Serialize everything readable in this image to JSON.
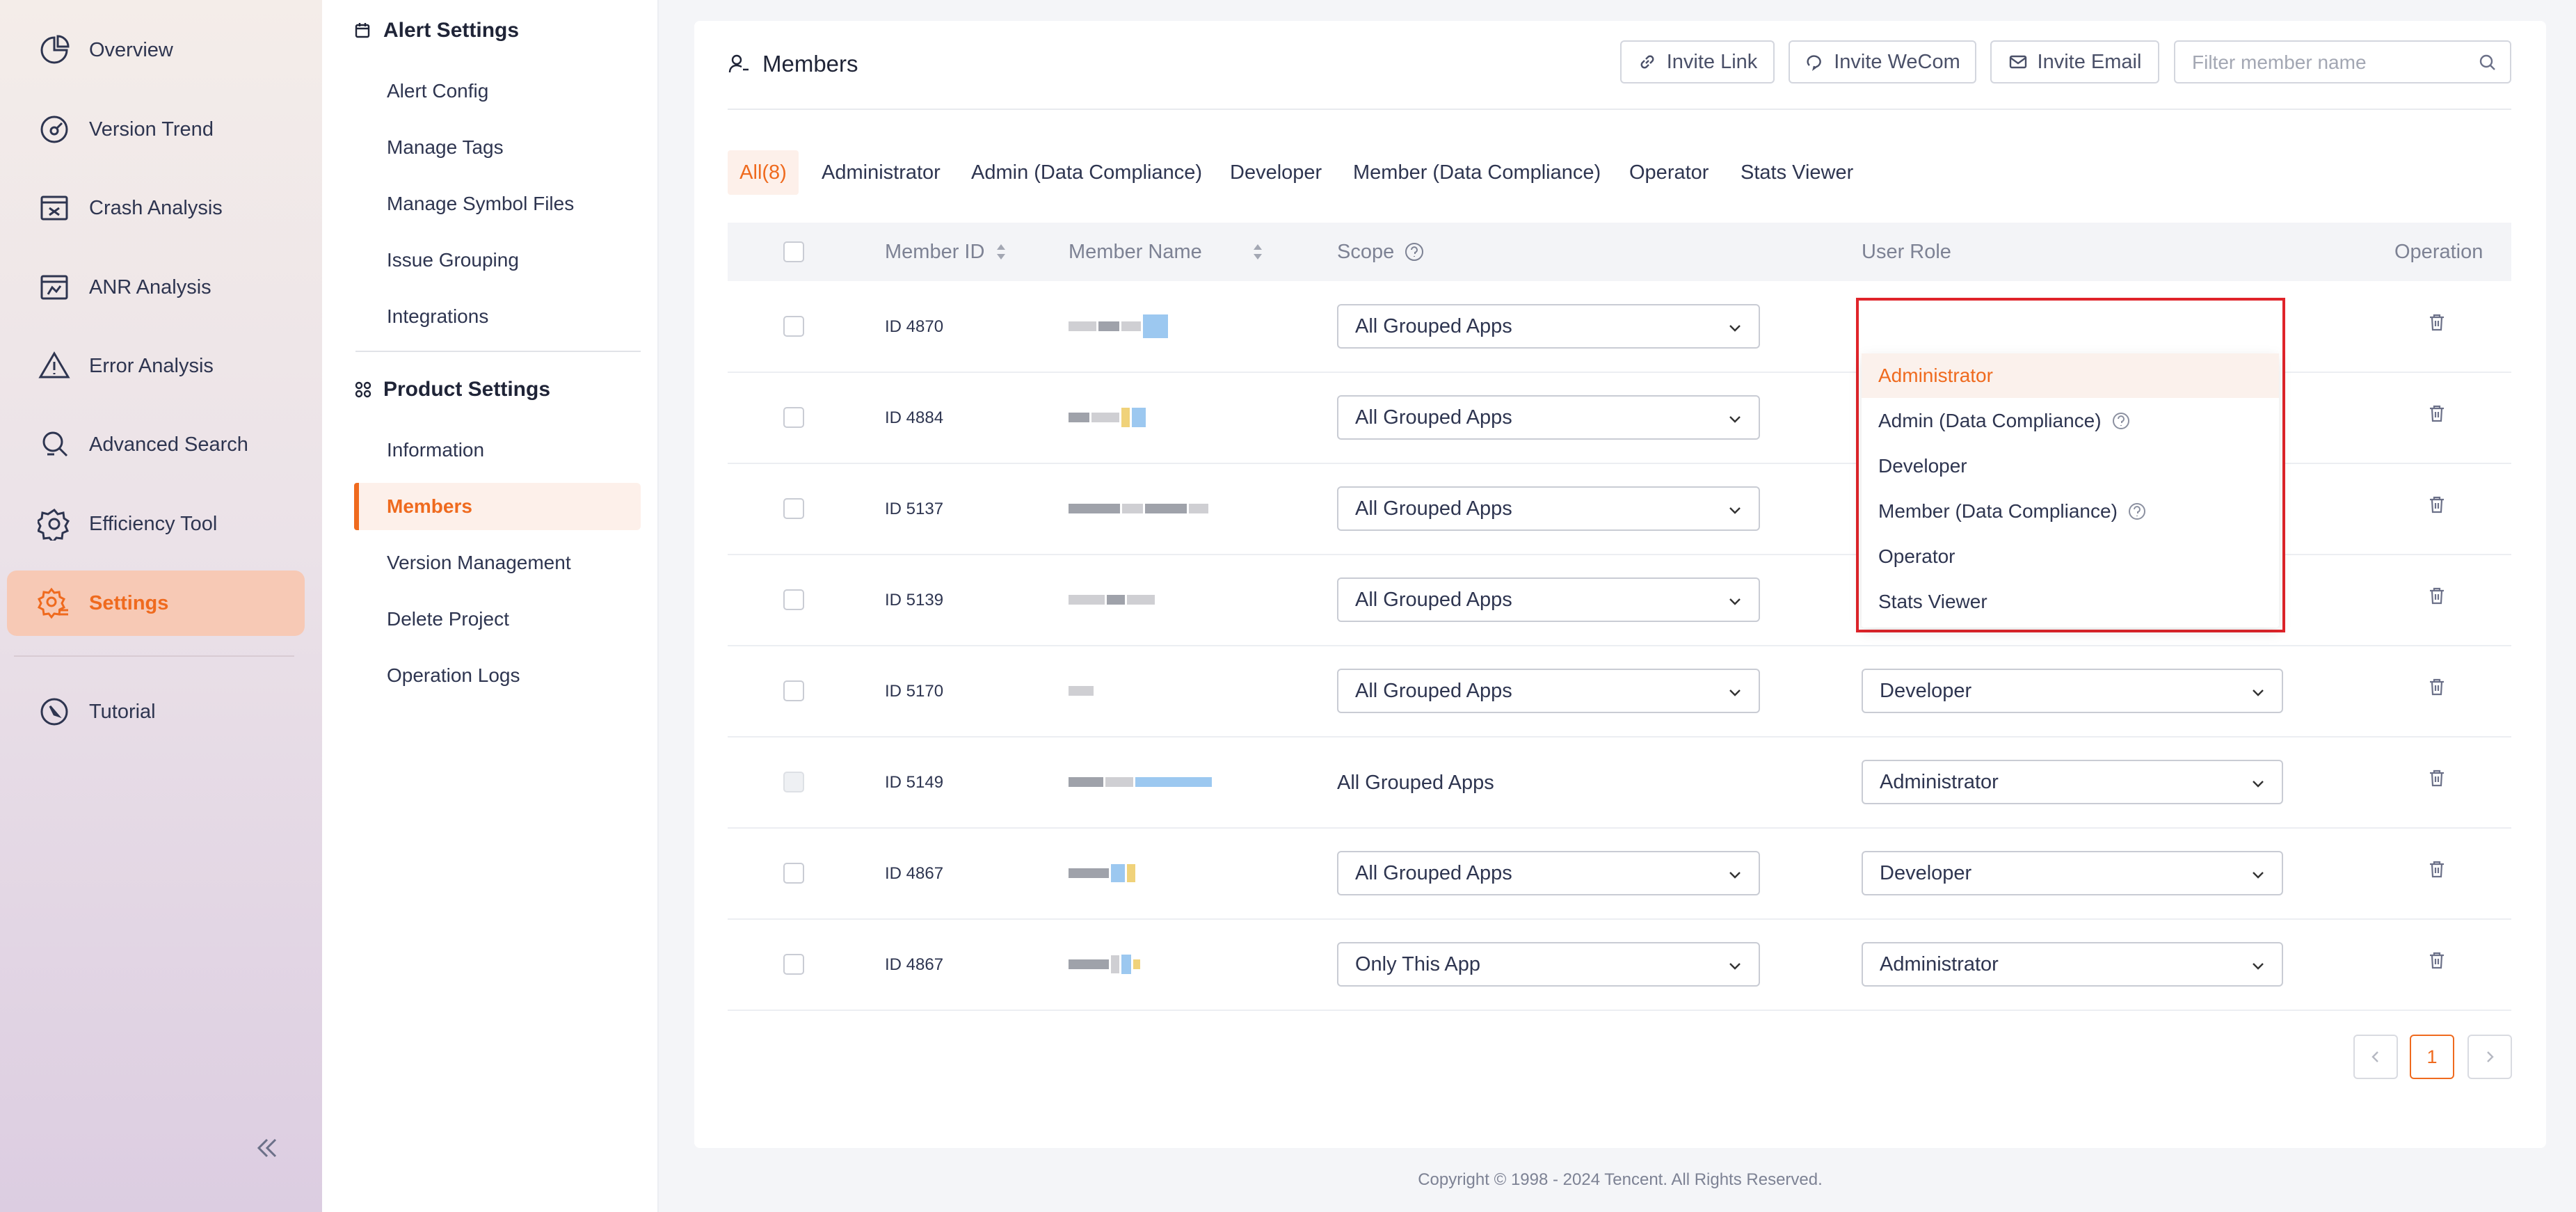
{
  "nav": {
    "items": [
      {
        "label": "Overview",
        "icon": "pie-chart-icon"
      },
      {
        "label": "Version Trend",
        "icon": "gauge-icon"
      },
      {
        "label": "Crash Analysis",
        "icon": "crash-icon"
      },
      {
        "label": "ANR Analysis",
        "icon": "anr-icon"
      },
      {
        "label": "Error Analysis",
        "icon": "warning-icon"
      },
      {
        "label": "Advanced Search",
        "icon": "magnifier-icon"
      },
      {
        "label": "Efficiency Tool",
        "icon": "gear-icon"
      },
      {
        "label": "Settings",
        "icon": "settings-icon"
      },
      {
        "label": "Tutorial",
        "icon": "compass-icon"
      }
    ],
    "active": "Settings"
  },
  "sub_nav": {
    "alert_header": "Alert Settings",
    "alert_items": [
      "Alert Config",
      "Manage Tags",
      "Manage Symbol Files",
      "Issue Grouping",
      "Integrations"
    ],
    "product_header": "Product Settings",
    "product_items": [
      "Information",
      "Members",
      "Version Management",
      "Delete Project",
      "Operation Logs"
    ],
    "active": "Members"
  },
  "page": {
    "title": "Members",
    "invite_link": "Invite Link",
    "invite_wecom": "Invite WeCom",
    "invite_email": "Invite Email",
    "search_placeholder": "Filter member name"
  },
  "tabs": [
    "All(8)",
    "Administrator",
    "Admin (Data Compliance)",
    "Developer",
    "Member (Data Compliance)",
    "Operator",
    "Stats Viewer"
  ],
  "active_tab": "All(8)",
  "table": {
    "headers": {
      "member_id": "Member ID",
      "member_name": "Member Name",
      "scope": "Scope",
      "user_role": "User Role",
      "operation": "Operation"
    },
    "rows": [
      {
        "id": "ID 4870",
        "scope": "All Grouped Apps",
        "role": "Administrator"
      },
      {
        "id": "ID 4884",
        "scope": "All Grouped Apps",
        "role": ""
      },
      {
        "id": "ID 5137",
        "scope": "All Grouped Apps",
        "role": ""
      },
      {
        "id": "ID 5139",
        "scope": "All Grouped Apps",
        "role": ""
      },
      {
        "id": "ID 5170",
        "scope": "All Grouped Apps",
        "role": "Developer"
      },
      {
        "id": "ID 5149",
        "scope": "All Grouped Apps",
        "role": "Administrator",
        "scope_locked": true
      },
      {
        "id": "ID 4867",
        "scope": "All Grouped Apps",
        "role": "Developer"
      },
      {
        "id": "ID 4867",
        "scope": "Only This App",
        "role": "Administrator"
      }
    ]
  },
  "role_dropdown": {
    "options": [
      "Administrator",
      "Admin (Data Compliance)",
      "Developer",
      "Member (Data Compliance)",
      "Operator",
      "Stats Viewer"
    ],
    "selected": "Administrator"
  },
  "pagination": {
    "current": "1"
  },
  "footer": "Copyright © 1998 - 2024 Tencent. All Rights Reserved.",
  "colors": {
    "accent": "#ef6a1e",
    "highlight_border": "#e0242a"
  }
}
